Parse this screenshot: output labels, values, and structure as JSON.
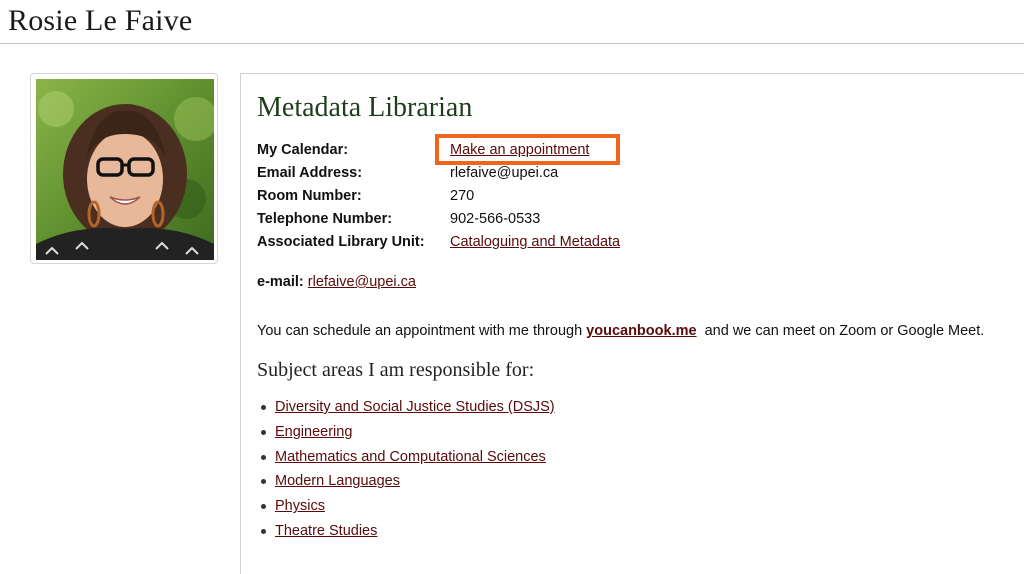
{
  "page": {
    "title": "Rosie Le Faive"
  },
  "profile": {
    "position_title": "Metadata Librarian",
    "rows": [
      {
        "label": "My Calendar:",
        "value": "Make an appointment"
      },
      {
        "label": "Email Address:",
        "value": "rlefaive@upei.ca"
      },
      {
        "label": "Room Number:",
        "value": "270"
      },
      {
        "label": "Telephone Number:",
        "value": "902-566-0533"
      },
      {
        "label": "Associated Library Unit:",
        "value": "Cataloguing and Metadata"
      }
    ]
  },
  "email_line": {
    "label": "e-mail:",
    "link": "rlefaive@upei.ca"
  },
  "schedule": {
    "prefix": "You can schedule an appointment with me through ",
    "link": "youcanbook.me",
    "suffix": "  and we can meet on Zoom or Google Meet."
  },
  "subjects": {
    "heading": "Subject areas I am responsible for:",
    "items": [
      "Diversity and Social Justice Studies (DSJS)",
      "Engineering",
      "Mathematics and Computational Sciences",
      "Modern Languages",
      "Physics",
      "Theatre Studies"
    ]
  },
  "colors": {
    "link": "#5a0a0a",
    "position_title": "#1e3d1c",
    "highlight": "#f0651b"
  }
}
